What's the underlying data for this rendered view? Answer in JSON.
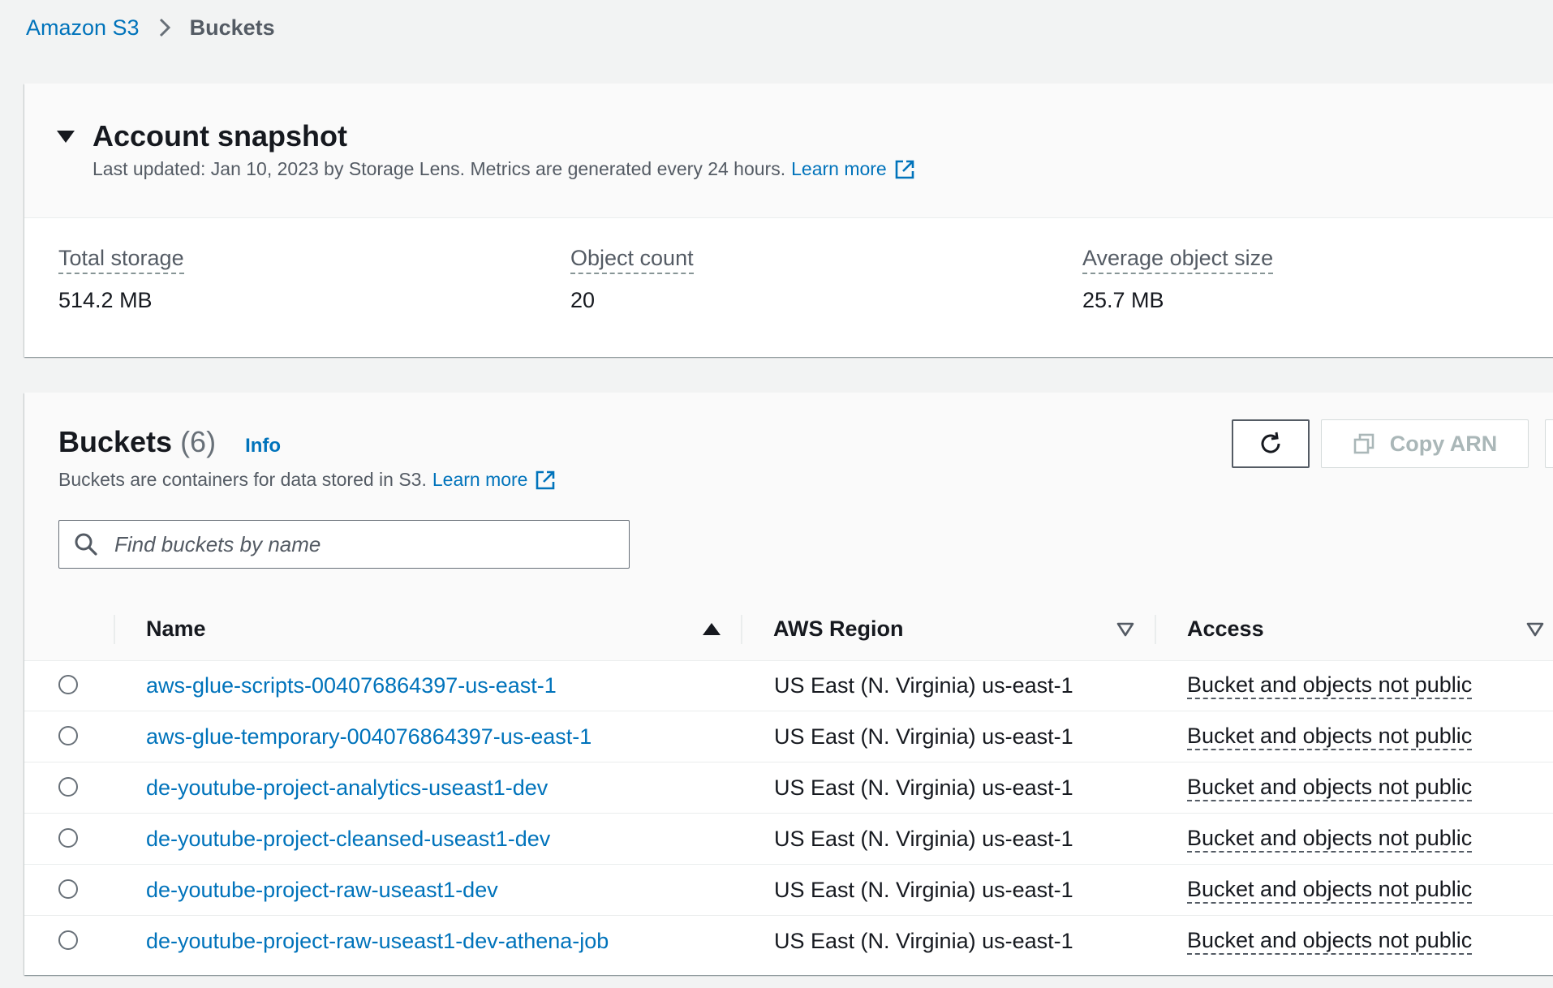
{
  "breadcrumb": {
    "root": "Amazon S3",
    "current": "Buckets"
  },
  "snapshot": {
    "title": "Account snapshot",
    "description": "Last updated: Jan 10, 2023 by Storage Lens. Metrics are generated every 24 hours.",
    "learn_more": "Learn more",
    "metrics": [
      {
        "label": "Total storage",
        "value": "514.2 MB"
      },
      {
        "label": "Object count",
        "value": "20"
      },
      {
        "label": "Average object size",
        "value": "25.7 MB"
      }
    ]
  },
  "buckets": {
    "title": "Buckets",
    "count": "(6)",
    "info": "Info",
    "description": "Buckets are containers for data stored in S3.",
    "learn_more": "Learn more",
    "search_placeholder": "Find buckets by name",
    "copy_arn_label": "Copy ARN",
    "columns": {
      "name": "Name",
      "region": "AWS Region",
      "access": "Access"
    },
    "rows": [
      {
        "name": "aws-glue-scripts-004076864397-us-east-1",
        "region": "US East (N. Virginia) us-east-1",
        "access": "Bucket and objects not public"
      },
      {
        "name": "aws-glue-temporary-004076864397-us-east-1",
        "region": "US East (N. Virginia) us-east-1",
        "access": "Bucket and objects not public"
      },
      {
        "name": "de-youtube-project-analytics-useast1-dev",
        "region": "US East (N. Virginia) us-east-1",
        "access": "Bucket and objects not public"
      },
      {
        "name": "de-youtube-project-cleansed-useast1-dev",
        "region": "US East (N. Virginia) us-east-1",
        "access": "Bucket and objects not public"
      },
      {
        "name": "de-youtube-project-raw-useast1-dev",
        "region": "US East (N. Virginia) us-east-1",
        "access": "Bucket and objects not public"
      },
      {
        "name": "de-youtube-project-raw-useast1-dev-athena-job",
        "region": "US East (N. Virginia) us-east-1",
        "access": "Bucket and objects not public"
      }
    ]
  },
  "colors": {
    "link": "#0073bb",
    "text": "#16191f",
    "muted": "#545b64",
    "background": "#f2f3f3"
  },
  "icons": {
    "breadcrumb_separator": "chevron-right-icon",
    "collapse": "caret-down-icon",
    "external_link": "external-link-icon",
    "refresh": "refresh-icon",
    "copy": "copy-icon",
    "search": "search-icon",
    "sort_ascending": "sort-ascending-icon",
    "sort_none": "sort-descending-outline-icon"
  }
}
